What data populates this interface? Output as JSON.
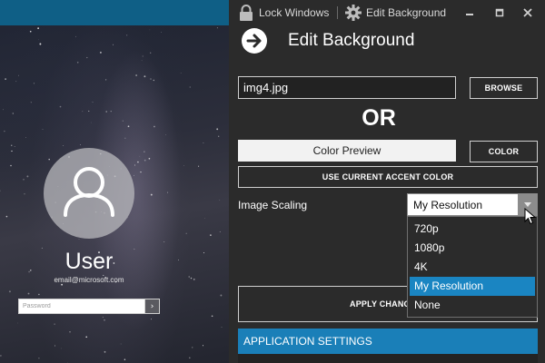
{
  "preview": {
    "user_name": "User",
    "user_email": "email@microsoft.com",
    "password_placeholder": "Password",
    "submit_glyph": "›"
  },
  "titlebar": {
    "lock_windows_label": "Lock Windows",
    "edit_background_label": "Edit Background"
  },
  "page": {
    "title": "Edit Background",
    "image_file_value": "img4.jpg",
    "browse_label": "BROWSE",
    "or_label": "OR",
    "color_preview_label": "Color Preview",
    "color_label": "COLOR",
    "accent_label": "USE CURRENT ACCENT COLOR",
    "image_scaling_label": "Image Scaling",
    "image_scaling_selected": "My Resolution",
    "image_scaling_options": [
      "720p",
      "1080p",
      "4K",
      "My Resolution",
      "None"
    ],
    "apply_label": "APPLY CHANG",
    "app_settings_label": "APPLICATION SETTINGS"
  },
  "colors": {
    "accent": "#1a85c2",
    "window_bg": "#2b2b2b",
    "preview_strip": "#0f5f86"
  },
  "icons": [
    "lock-icon",
    "gear-icon",
    "minimize-icon",
    "maximize-icon",
    "close-icon",
    "back-arrow-icon",
    "user-icon",
    "dropdown-arrow-icon",
    "mouse-cursor-icon"
  ]
}
